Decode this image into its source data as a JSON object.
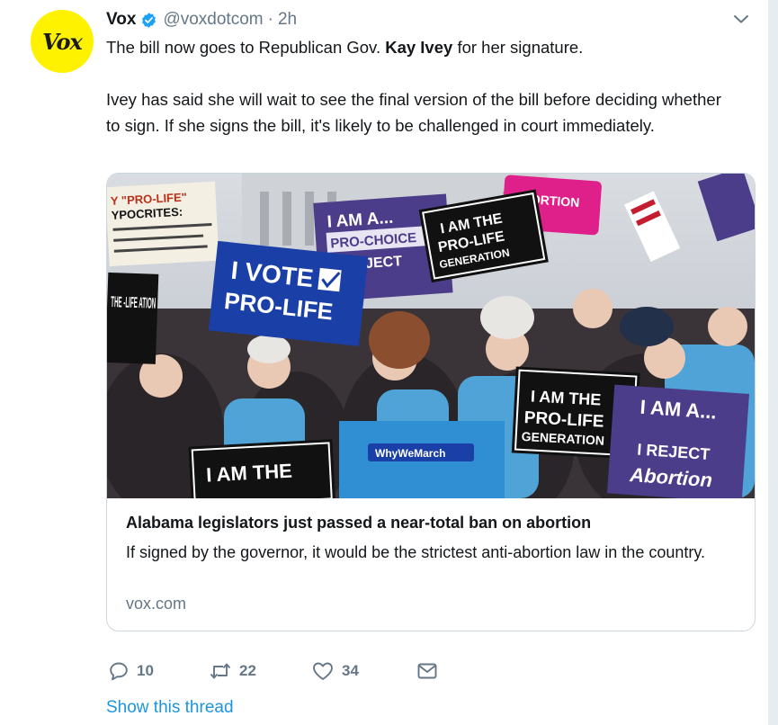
{
  "tweet": {
    "avatar_text": "Vox",
    "display_name": "Vox",
    "handle": "@voxdotcom",
    "separator": "·",
    "timestamp": "2h",
    "text_p1_before": "The bill now goes to Republican Gov. ",
    "text_p1_bold": "Kay Ivey",
    "text_p1_after": " for her signature.",
    "text_p2": "Ivey has said she will wait to see the final version of the bill before deciding whether to sign. If she signs the bill, it's likely to be challenged in court immediately.",
    "card": {
      "title": "Alabama legislators just passed a near-total ban on abortion",
      "description": "If signed by the governor, it would be the strictest anti-abortion law in the country.",
      "domain": "vox.com",
      "photo_signs": {
        "hypocrites_line1": "Y \"PRO-LIFE\"",
        "hypocrites_line2": "YPOCRITES:",
        "vote_line1": "I VOTE",
        "vote_line2": "PRO-LIFE",
        "gen_line1": "I AM THE",
        "gen_line2": "PRO-LIFE",
        "gen_line3": "GENERATION",
        "purple_line1": "I AM A...",
        "purple_line2": "PRO-CHOICE",
        "purple_line3": "I REJECT",
        "purple_line4": "Abortion",
        "left_sign": "THE -LIFE ATION",
        "bottom_sign": "I AM THE",
        "whywe": "WhyWeMarch",
        "pink": "ABORTION"
      }
    },
    "actions": {
      "reply_count": "10",
      "retweet_count": "22",
      "like_count": "34"
    },
    "show_thread": "Show this thread"
  },
  "colors": {
    "accent": "#1b95e0",
    "avatar_bg": "#fff200",
    "muted": "#657786",
    "verified": "#1da1f2"
  }
}
